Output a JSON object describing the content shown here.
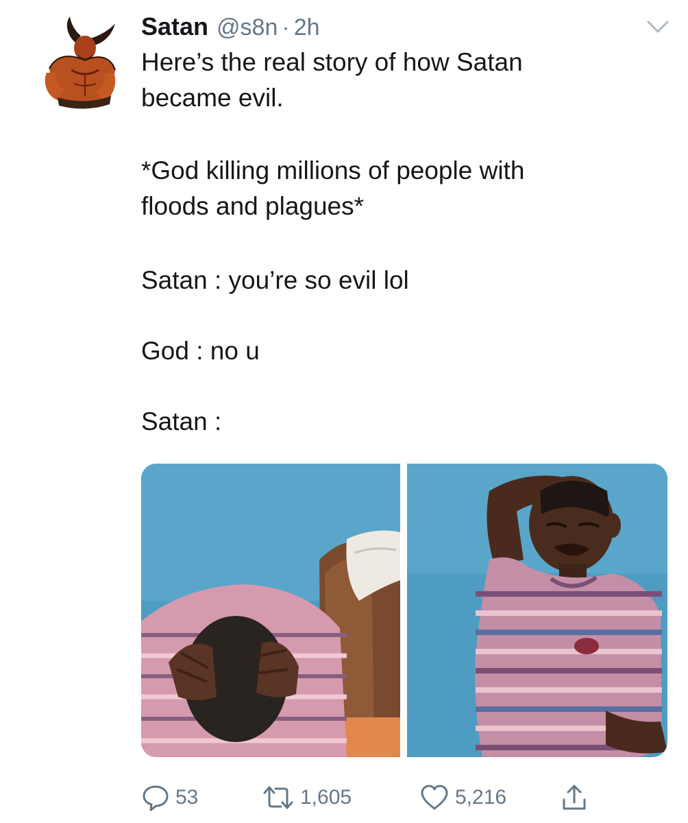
{
  "tweet": {
    "author": {
      "display_name": "Satan",
      "handle": "@s8n",
      "separator": "·",
      "time": "2h",
      "avatar_icon": "devil-avatar"
    },
    "text_lines": [
      "Here’s the real story of how Satan",
      "became evil.",
      "*God killing millions of people with",
      "floods and plagues*",
      "Satan : you’re so evil lol",
      "God : no u",
      "Satan :"
    ],
    "media": {
      "count": 2,
      "panels": [
        "crying-kid-head-in-hands",
        "crying-kid-hand-on-head"
      ]
    },
    "actions": {
      "reply_count": "53",
      "retweet_count": "1,605",
      "like_count": "5,216",
      "share_icon": "share-icon"
    },
    "colors": {
      "text": "#14171a",
      "secondary": "#657786",
      "background": "#ffffff",
      "photo_wall": "#4e9cc2"
    }
  }
}
